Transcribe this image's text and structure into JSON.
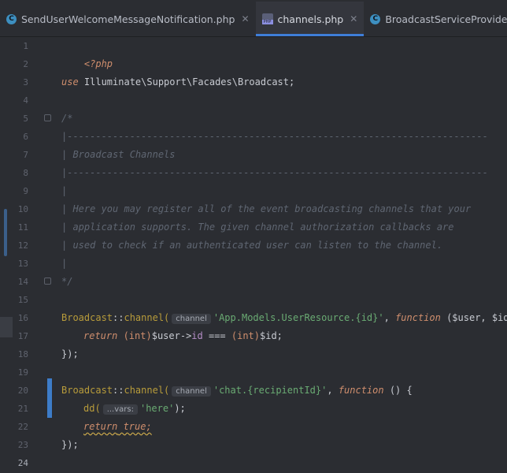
{
  "tabs": [
    {
      "label": "SendUserWelcomeMessageNotification.php",
      "icon": "class-icon",
      "active": false
    },
    {
      "label": "channels.php",
      "icon": "php-file-icon",
      "active": true
    },
    {
      "label": "BroadcastServiceProvider.php",
      "icon": "class-icon",
      "active": false
    }
  ],
  "editor": {
    "line_numbers": [
      "1",
      "2",
      "3",
      "4",
      "5",
      "6",
      "7",
      "8",
      "9",
      "10",
      "11",
      "12",
      "13",
      "14",
      "15",
      "16",
      "17",
      "18",
      "19",
      "20",
      "21",
      "22",
      "23",
      "24"
    ],
    "lines": {
      "l1": "<?php",
      "l3_kw": "use",
      "l3_ns": " Illuminate\\Support\\Facades\\Broadcast;",
      "l5": "/*",
      "l6": "|--------------------------------------------------------------------------",
      "l7": "| Broadcast Channels",
      "l8": "|--------------------------------------------------------------------------",
      "l9": "|",
      "l10": "| Here you may register all of the event broadcasting channels that your",
      "l11": "| application supports. The given channel authorization callbacks are",
      "l12": "| used to check if an authenticated user can listen to the channel.",
      "l13": "|",
      "l14": "*/",
      "l16_class": "Broadcast",
      "l16_op": "::",
      "l16_method": "channel(",
      "l16_hint": "channel",
      "l16_str": "'App.Models.UserResource.{id}'",
      "l16_comma": ", ",
      "l16_fn": "function",
      "l16_args": " ($user, $id) {",
      "l17_ret": "return",
      "l17_cast1": " (int)",
      "l17_var": "$user",
      "l17_arrow": "->",
      "l17_prop": "id",
      "l17_rest": " === ",
      "l17_cast2": "(int)",
      "l17_id": "$id;",
      "l18": "});",
      "l20_class": "Broadcast",
      "l20_op": "::",
      "l20_method": "channel(",
      "l20_hint": "channel",
      "l20_str": "'chat.{recipientId}'",
      "l20_comma": ", ",
      "l20_fn": "function",
      "l20_args": " () {",
      "l21_fn": "dd(",
      "l21_hint": "...vars:",
      "l21_str": "'here'",
      "l21_end": ");",
      "l22_ret": "return",
      "l22_true": " true;",
      "l23": "});"
    }
  }
}
